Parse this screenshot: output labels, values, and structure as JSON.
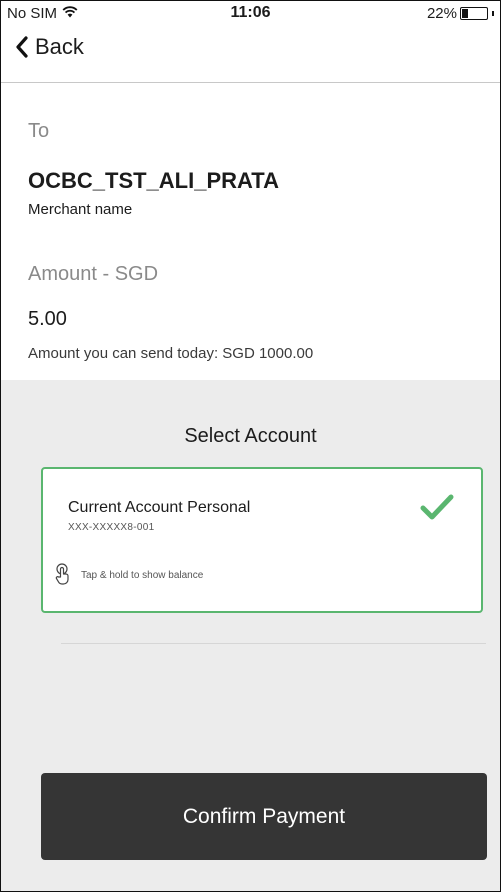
{
  "status_bar": {
    "carrier": "No SIM",
    "time": "11:06",
    "battery": "22%",
    "battery_level": 0.22,
    "wifi_icon": "wifi-icon",
    "battery_icon": "battery-icon"
  },
  "nav": {
    "back_label": "Back",
    "back_icon": "chevron-left-icon"
  },
  "payment": {
    "to_label": "To",
    "merchant": "OCBC_TST_ALI_PRATA",
    "merchant_sublabel": "Merchant name",
    "amount_label": "Amount - SGD",
    "amount": "5.00",
    "limit_text": "Amount you can send today: SGD 1000.00"
  },
  "account_section": {
    "title": "Select Account",
    "account": {
      "name": "Current Account Personal",
      "number": "XXX-XXXXX8-001",
      "selected": true,
      "hint": "Tap & hold to show balance",
      "check_icon": "checkmark-icon",
      "hint_icon": "tap-hold-icon"
    }
  },
  "actions": {
    "confirm_label": "Confirm Payment"
  },
  "colors": {
    "accent_green": "#5ab66f",
    "button_dark": "#353535",
    "section_bg": "#ececec"
  }
}
